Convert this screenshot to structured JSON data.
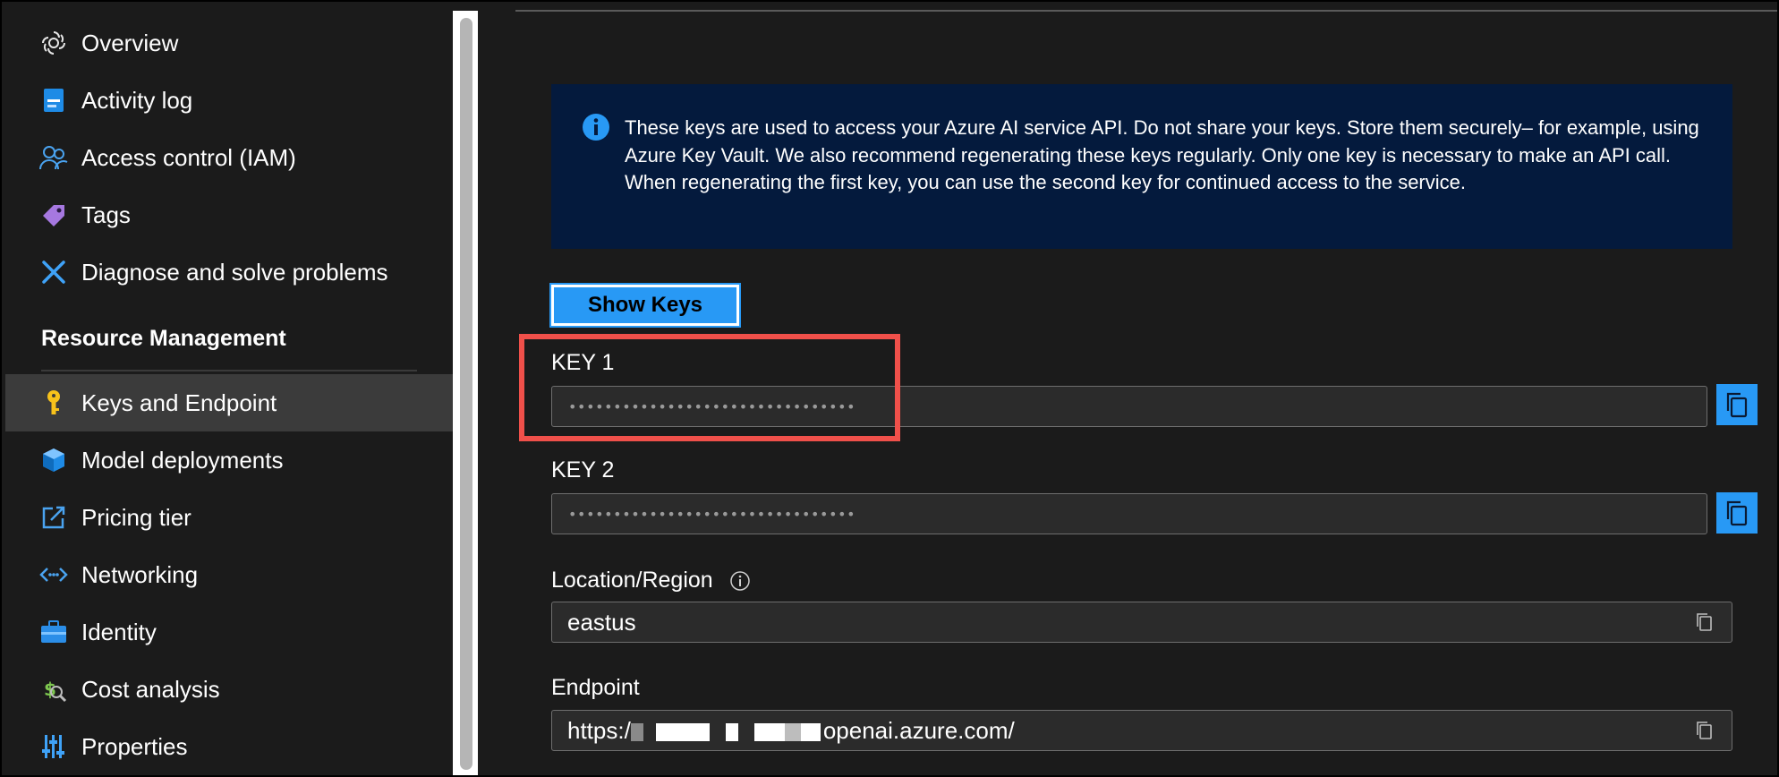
{
  "sidebar": {
    "items": [
      {
        "label": "Overview",
        "icon": "openai-icon"
      },
      {
        "label": "Activity log",
        "icon": "activity-log-icon"
      },
      {
        "label": "Access control (IAM)",
        "icon": "people-icon"
      },
      {
        "label": "Tags",
        "icon": "tag-icon"
      },
      {
        "label": "Diagnose and solve problems",
        "icon": "wrench-icon"
      }
    ],
    "section_header": "Resource Management",
    "section_items": [
      {
        "label": "Keys and Endpoint",
        "icon": "key-icon",
        "selected": true
      },
      {
        "label": "Model deployments",
        "icon": "cube-icon"
      },
      {
        "label": "Pricing tier",
        "icon": "external-edit-icon"
      },
      {
        "label": "Networking",
        "icon": "networking-icon"
      },
      {
        "label": "Identity",
        "icon": "briefcase-icon"
      },
      {
        "label": "Cost analysis",
        "icon": "cost-analysis-icon"
      },
      {
        "label": "Properties",
        "icon": "sliders-icon"
      }
    ]
  },
  "main": {
    "info_message": "These keys are used to access your Azure AI service API. Do not share your keys. Store them securely– for example, using Azure Key Vault. We also recommend regenerating these keys regularly. Only one key is necessary to make an API call. When regenerating the first key, you can use the second key for continued access to the service.",
    "show_keys_label": "Show Keys",
    "key1": {
      "label": "KEY 1",
      "value": "••••••••••••••••••••••••••••••••"
    },
    "key2": {
      "label": "KEY 2",
      "value": "••••••••••••••••••••••••••••••••"
    },
    "location": {
      "label": "Location/Region",
      "value": "eastus"
    },
    "endpoint": {
      "label": "Endpoint",
      "prefix": "https:/",
      "suffix": "openai.azure.com/"
    }
  },
  "colors": {
    "accent": "#2899f5",
    "info_bg": "#041a3d",
    "highlight": "#f0504a",
    "selected_bg": "#3b3b3b"
  }
}
